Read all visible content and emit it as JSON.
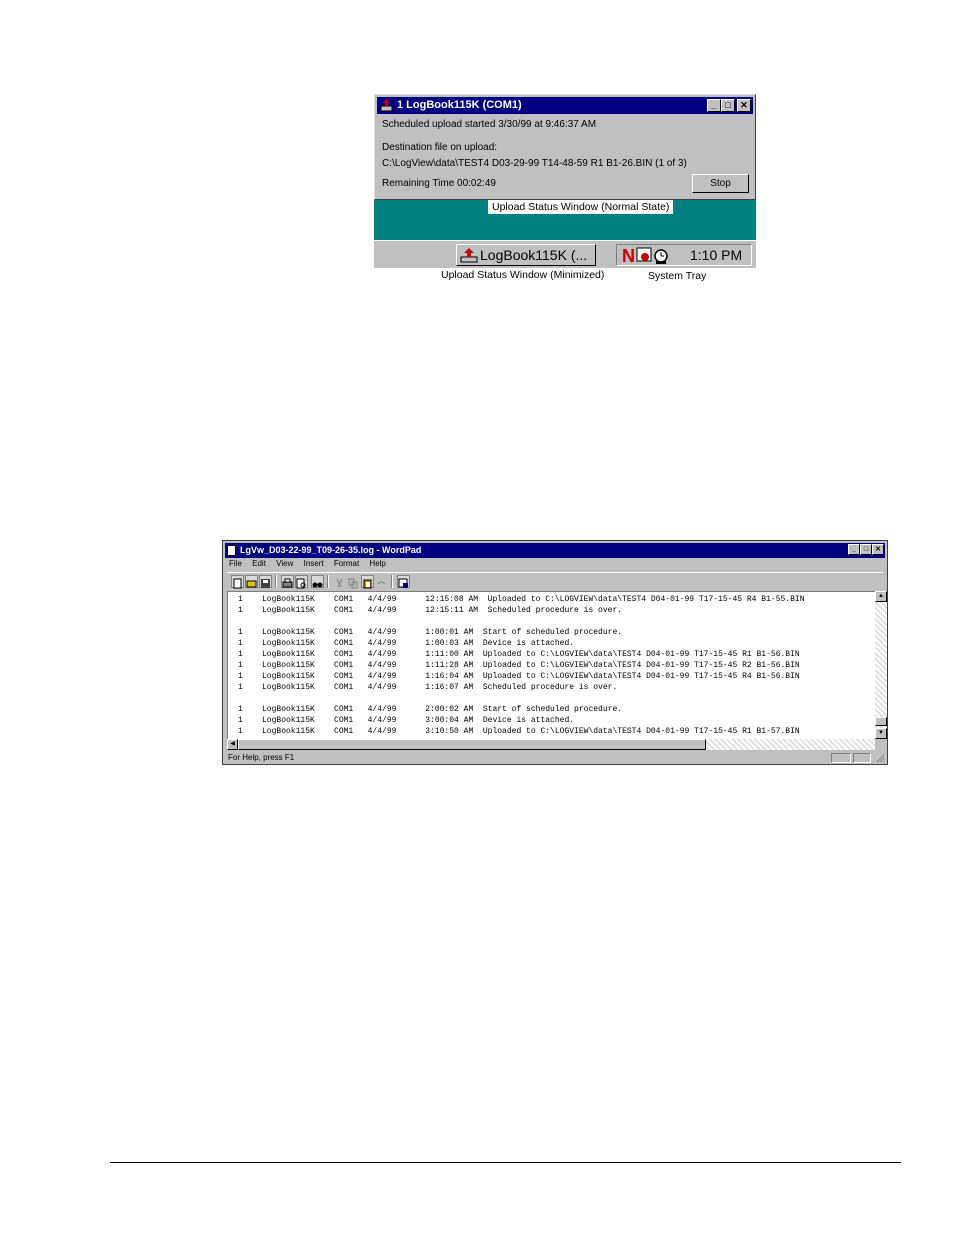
{
  "figure1": {
    "upload_window": {
      "title": "1 LogBook115K (COM1)",
      "scheduled_text": "Scheduled upload started 3/30/99 at 9:46:37 AM",
      "destination_label": "Destination file on upload:",
      "destination_path": "C:\\LogView\\data\\TEST4 D03-29-99 T14-48-59 R1 B1-26.BIN   (1 of 3)",
      "remaining_time": "Remaining Time 00:02:49",
      "stop_button": "Stop"
    },
    "caption_normal": "Upload Status Window (Normal State)",
    "taskbar_button": "LogBook115K (...",
    "tray_clock": "1:10 PM",
    "label_minimized": "Upload Status Window (Minimized)",
    "label_tray": "System Tray",
    "colors": {
      "titlebar": "#000080",
      "desktop": "#008080",
      "face": "#c0c0c0"
    }
  },
  "figure2": {
    "title": "LgVw_D03-22-99_T09-26-35.log - WordPad",
    "menu": [
      "File",
      "Edit",
      "View",
      "Insert",
      "Format",
      "Help"
    ],
    "log_lines": [
      "1    LogBook115K    COM1   4/4/99      12:15:08 AM  Uploaded to C:\\LOGVIEW\\data\\TEST4 D04-01-99 T17-15-45 R4 B1-55.BIN",
      "1    LogBook115K    COM1   4/4/99      12:15:11 AM  Scheduled procedure is over.",
      "",
      "1    LogBook115K    COM1   4/4/99      1:00:01 AM  Start of scheduled procedure.",
      "1    LogBook115K    COM1   4/4/99      1:00:03 AM  Device is attached.",
      "1    LogBook115K    COM1   4/4/99      1:11:00 AM  Uploaded to C:\\LOGVIEW\\data\\TEST4 D04-01-99 T17-15-45 R1 B1-56.BIN",
      "1    LogBook115K    COM1   4/4/99      1:11:28 AM  Uploaded to C:\\LOGVIEW\\data\\TEST4 D04-01-99 T17-15-45 R2 B1-56.BIN",
      "1    LogBook115K    COM1   4/4/99      1:16:04 AM  Uploaded to C:\\LOGVIEW\\data\\TEST4 D04-01-99 T17-15-45 R4 B1-56.BIN",
      "1    LogBook115K    COM1   4/4/99      1:16:07 AM  Scheduled procedure is over.",
      "",
      "1    LogBook115K    COM1   4/4/99      2:00:02 AM  Start of scheduled procedure.",
      "1    LogBook115K    COM1   4/4/99      3:00:04 AM  Device is attached.",
      "1    LogBook115K    COM1   4/4/99      3:10:50 AM  Uploaded to C:\\LOGVIEW\\data\\TEST4 D04-01-99 T17-15-45 R1 B1-57.BIN"
    ],
    "status_text": "For Help, press F1"
  }
}
